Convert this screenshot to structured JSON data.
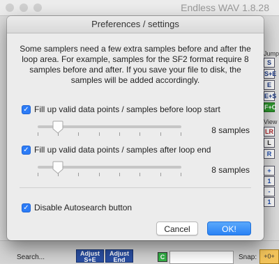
{
  "app": {
    "title": "Endless WAV 1.8.28"
  },
  "dialog": {
    "title": "Preferences / settings",
    "description": "Some samplers need a few extra samples before and after the loop area. For example, samples for the SF2 format require 8 samples before and after. If you save your file to disk, the samples will be added accordingly.",
    "option_before": {
      "label": "Fill up valid data points / samples before loop start",
      "checked": true,
      "value_label": "8 samples"
    },
    "option_after": {
      "label": "Fill up valid data points / samples after loop end",
      "checked": true,
      "value_label": "8 samples"
    },
    "option_autosearch": {
      "label": "Disable Autosearch button",
      "checked": true
    },
    "cancel_label": "Cancel",
    "ok_label": "OK!"
  },
  "background": {
    "jump_label": "Jump",
    "view_label": "View",
    "jump_buttons": [
      "S",
      "S+E",
      "E",
      "E+S",
      "F+C"
    ],
    "view_buttons": [
      "LR",
      "L",
      "R"
    ],
    "zoom_buttons": [
      "+",
      "1",
      "-",
      "1"
    ],
    "search_label": "Search...",
    "adjust_buttons": [
      "Adjust S+E",
      "Adjust End"
    ],
    "snap_label": "Snap:",
    "snap_value": "+0+",
    "c_label": "C"
  }
}
